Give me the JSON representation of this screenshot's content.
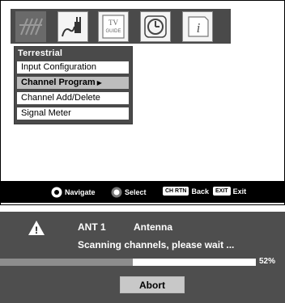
{
  "menu": {
    "icons": [
      "antenna-icon",
      "plug-icon",
      "tv-guide-icon",
      "clock-icon",
      "info-icon"
    ],
    "tv_guide_icon_text": [
      "TV",
      "GUIDE"
    ],
    "panel_title": "Terrestrial",
    "items": [
      {
        "label": "Input Configuration"
      },
      {
        "label": "Channel Program",
        "arrow": "▶"
      },
      {
        "label": "Channel Add/Delete"
      },
      {
        "label": "Signal Meter"
      }
    ],
    "selected_item": "Channel Program"
  },
  "navbar": {
    "navigate_label": "Navigate",
    "select_label": "Select",
    "back_key": "CH RTN",
    "back_label": "Back",
    "exit_key": "EXIT",
    "exit_label": "Exit"
  },
  "scan": {
    "warning_glyph": "!",
    "input_name": "ANT 1",
    "input_type": "Antenna",
    "message": "Scanning channels, please wait ...",
    "progress_percent_text": "52%",
    "progress_fraction": 0.52,
    "abort_label": "Abort"
  },
  "colors": {
    "panel_gray": "#4e4e4e",
    "progress_fill": "#8d8d8d",
    "selected_item": "#bdbdbd"
  }
}
